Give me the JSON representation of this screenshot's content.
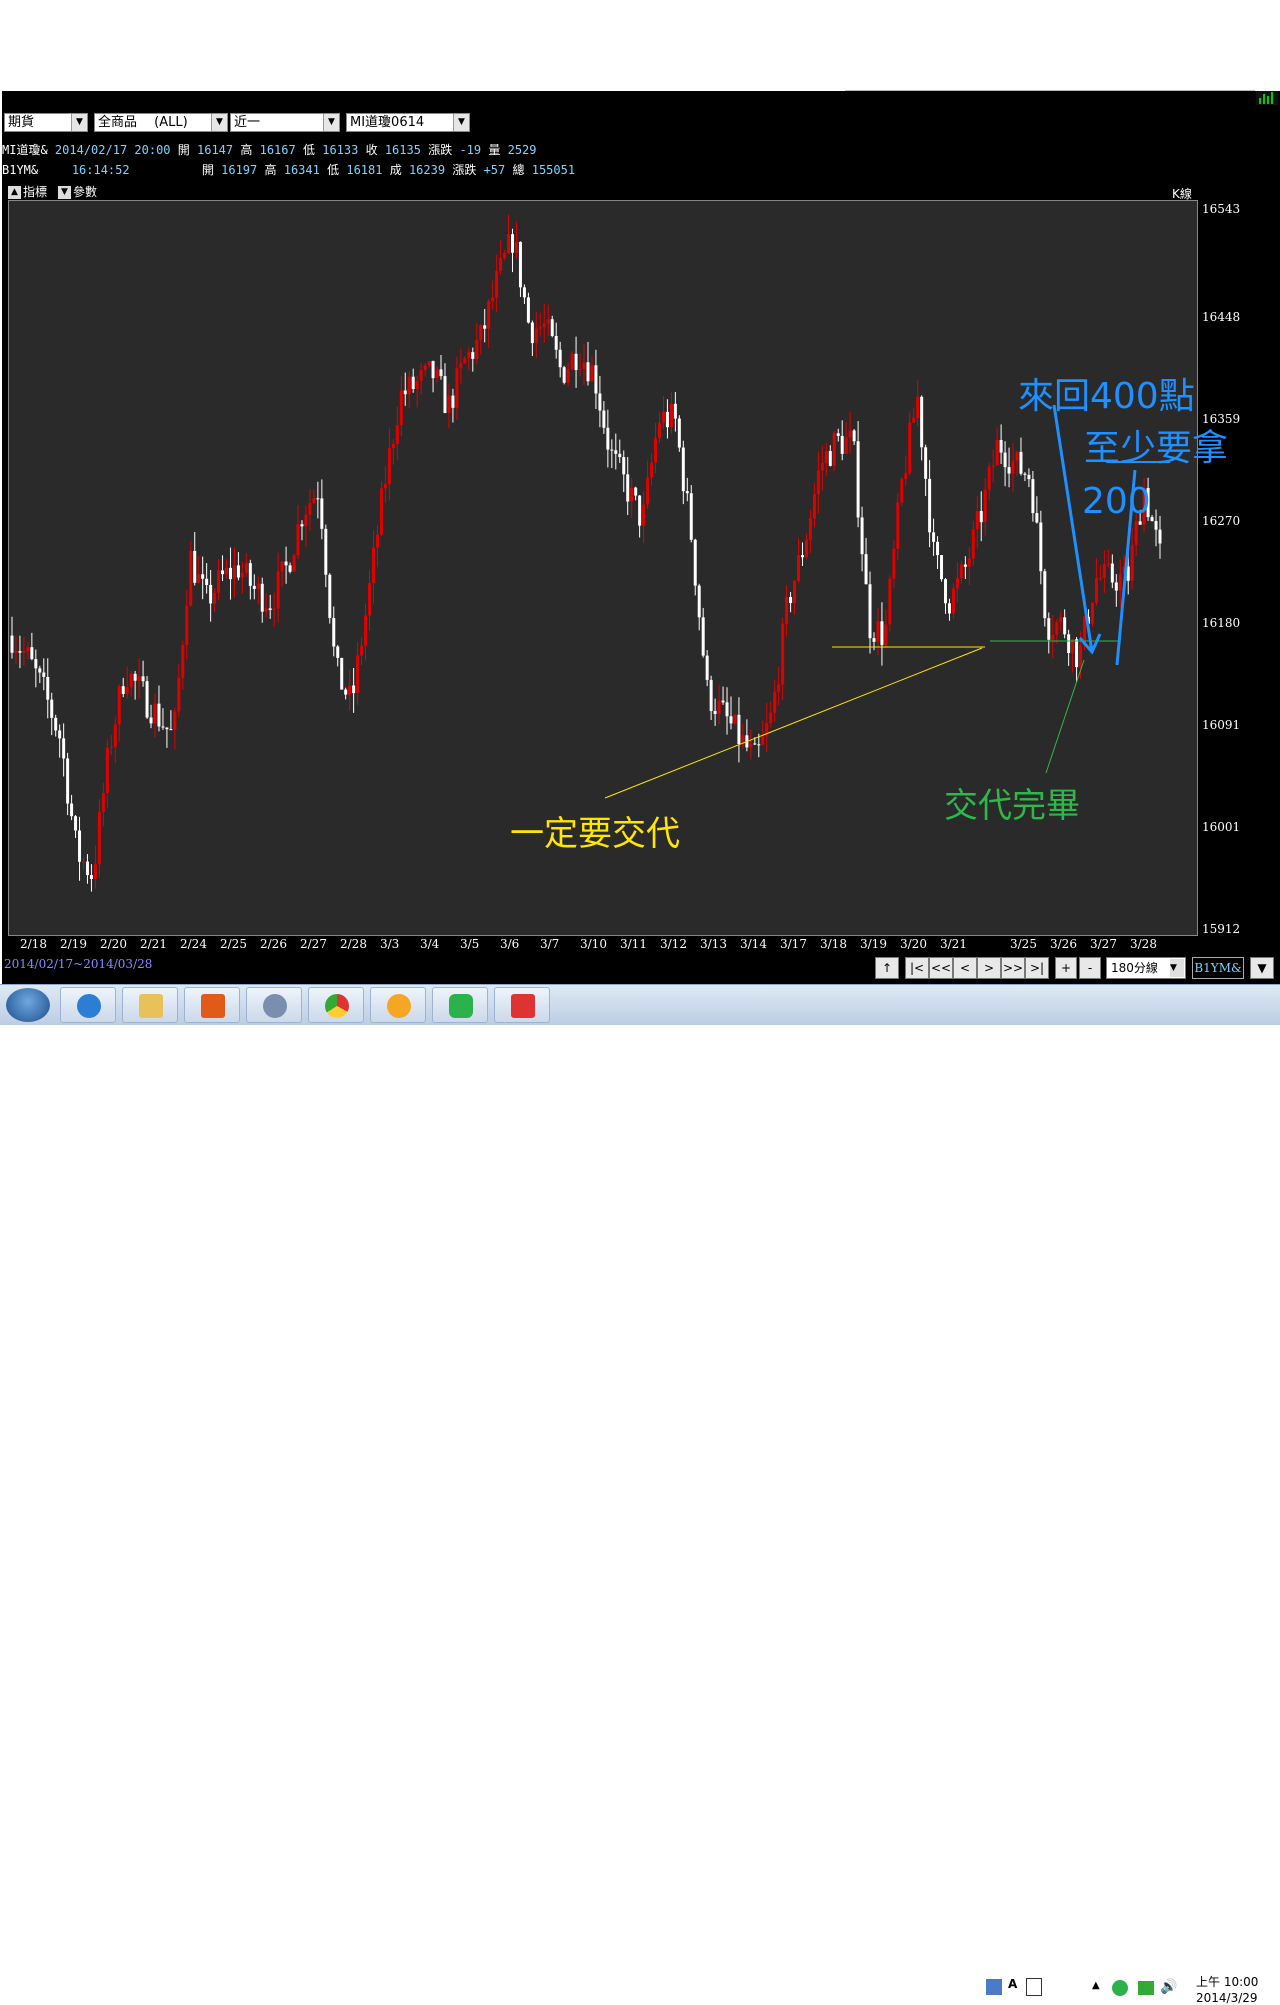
{
  "toolbar": {
    "selectors": [
      "期貨",
      "全商品　 (ALL)",
      "近一",
      "MI道瓊0614"
    ]
  },
  "info_rows": [
    {
      "symbol": "MI道瓊&",
      "datetime": "2014/02/17 20:00",
      "open_label": "開",
      "open": "16147",
      "high_label": "高",
      "high": "16167",
      "low_label": "低",
      "low": "16133",
      "close_label": "收",
      "close": "16135",
      "change_label": "漲跌",
      "change": "-19",
      "vol_label": "量",
      "vol": "2529"
    },
    {
      "symbol": "B1YM&",
      "datetime": "　16:14:52",
      "open_label": "開",
      "open": "16197",
      "high_label": "高",
      "high": "16341",
      "low_label": "低",
      "low": "16181",
      "close_label": "成",
      "close": "16239",
      "change_label": "漲跌",
      "change": "+57",
      "vol_label": "總",
      "vol": "155051"
    }
  ],
  "panel_buttons": {
    "indicator": "指標",
    "params": "參數"
  },
  "chart_type_label": "K線",
  "date_range": "2014/02/17~2014/03/28",
  "nav": {
    "period": "180分線",
    "symbol_box": "B1YM&"
  },
  "colors": {
    "up": "#e00000",
    "down": "#ffffff",
    "background": "#2a2a2a",
    "annotation_blue": "#1e90ff",
    "annotation_yellow": "#ffe600",
    "annotation_green": "#2db84a"
  },
  "annotations": {
    "yellow_text": "一定要交代",
    "green_text": "交代完畢",
    "blue_line1": "來回400點",
    "blue_line2": "至少要拿",
    "blue_line3": "200"
  },
  "taskbar": {
    "time": "上午 10:00",
    "date": "2014/3/29",
    "ime": "A"
  },
  "chart_data": {
    "type": "candlestick",
    "y_ticks": [
      "16543",
      "16448",
      "16359",
      "16270",
      "16180",
      "16091",
      "16001",
      "15912"
    ],
    "ylim": [
      15912,
      16543
    ],
    "x_labels": [
      "2/18",
      "2/19",
      "2/20",
      "2/21",
      "2/24",
      "2/25",
      "2/26",
      "2/27",
      "2/28",
      "3/3",
      "3/4",
      "3/5",
      "3/6",
      "3/7",
      "3/10",
      "3/11",
      "3/12",
      "3/13",
      "3/14",
      "3/17",
      "3/18",
      "3/19",
      "3/20",
      "3/21",
      "3/25",
      "3/26",
      "3/27",
      "3/28"
    ],
    "close_path": [
      16170,
      16150,
      16120,
      16080,
      15980,
      15960,
      16070,
      16140,
      16120,
      16100,
      16080,
      16240,
      16200,
      16220,
      16230,
      16210,
      16200,
      16230,
      16280,
      16300,
      16140,
      16110,
      16200,
      16300,
      16380,
      16390,
      16400,
      16370,
      16410,
      16430,
      16480,
      16520,
      16440,
      16440,
      16400,
      16420,
      16400,
      16330,
      16300,
      16270,
      16360,
      16360,
      16260,
      16120,
      16100,
      16080,
      16060,
      16100,
      16200,
      16250,
      16320,
      16340,
      16340,
      16180,
      16170,
      16300,
      16380,
      16240,
      16200,
      16230,
      16280,
      16340,
      16320,
      16310,
      16180,
      16180,
      16150,
      16220,
      16220,
      16220,
      16300,
      16240
    ]
  }
}
